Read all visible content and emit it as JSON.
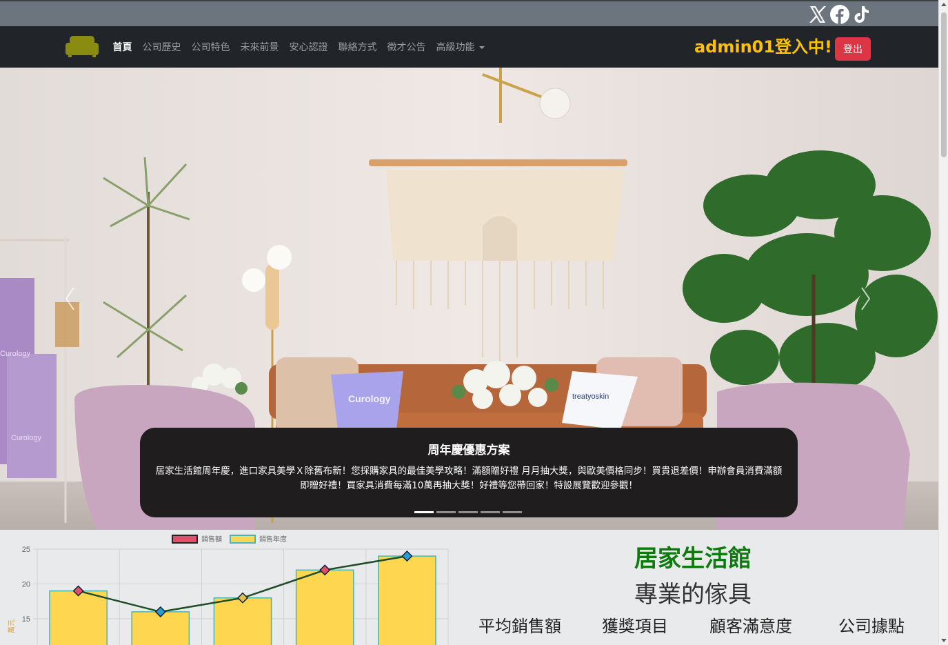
{
  "nav": {
    "items": [
      {
        "label": "首頁",
        "active": true
      },
      {
        "label": "公司歷史"
      },
      {
        "label": "公司特色"
      },
      {
        "label": "未來前景"
      },
      {
        "label": "安心認證"
      },
      {
        "label": "聯絡方式"
      },
      {
        "label": "徵才公告"
      },
      {
        "label": "高級功能",
        "dropdown": true
      }
    ],
    "login_text": "admin01登入中!",
    "logout_label": "登出"
  },
  "social": [
    "x-icon",
    "facebook-icon",
    "tiktok-icon"
  ],
  "hero": {
    "caption_title": "周年慶優惠方案",
    "caption_text": "居家生活館周年慶，進口家具美學Ｘ除舊布新！您採購家具的最佳美學攻略！滿額贈好禮 月月抽大獎，與歐美價格同步！買貴退差價！申辦會員消費滿額即贈好禮！買家具消費每滿10萬再抽大獎！好禮等您帶回家！特設展覽歡迎參觀！",
    "slide_count": 5,
    "active_slide": 0,
    "pillow_left_text": "Curology",
    "pillow_right_text": "treatyoskin",
    "towel_text_1": "Curology",
    "towel_text_2": "Curology"
  },
  "info": {
    "title": "居家生活館",
    "subtitle": "專業的傢具",
    "stats": [
      "平均銷售額",
      "獲獎項目",
      "顧客滿意度",
      "公司據點"
    ]
  },
  "colors": {
    "brand": "#8a8c12",
    "login": "#ffc107",
    "logout": "#dc3545",
    "title_green": "#0c7a0c",
    "bar_fill": "#ffd64f",
    "bar_stroke": "#4ab5b0",
    "line": "#1f4d2a"
  },
  "chart_data": {
    "type": "bar",
    "categories": [
      "",
      "",
      "",
      "",
      ""
    ],
    "series": [
      {
        "name": "銷售額",
        "type": "line",
        "values": [
          19,
          16,
          18,
          22,
          24
        ]
      },
      {
        "name": "銷售年度",
        "type": "bar",
        "values": [
          19,
          16,
          18,
          22,
          24
        ]
      }
    ],
    "yticks": [
      15,
      20,
      25
    ],
    "ylim": [
      10,
      25
    ],
    "grid": true,
    "legend": "top",
    "side_label": "萬元"
  }
}
